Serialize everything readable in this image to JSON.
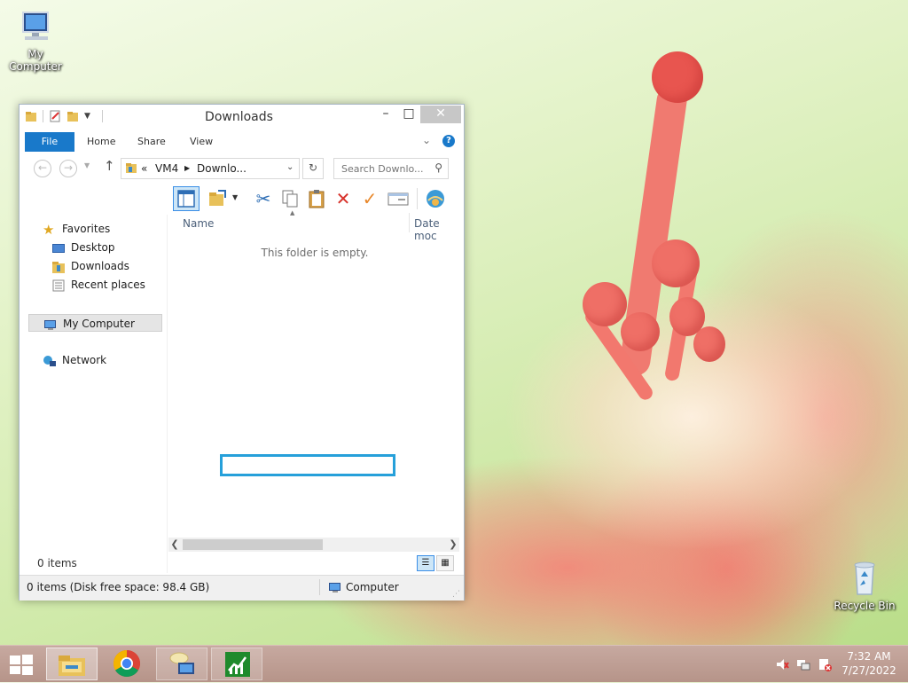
{
  "desktop": {
    "icons": [
      {
        "label": "My Computer"
      },
      {
        "label": "Recycle Bin"
      }
    ]
  },
  "window": {
    "title": "Downloads",
    "controls": {
      "minimize": "–",
      "maximize": "□",
      "close": "✕"
    },
    "ribbon_tabs": [
      "File",
      "Home",
      "Share",
      "View"
    ],
    "address": {
      "prefix": "«",
      "segments": [
        "VM4",
        "Downlo..."
      ]
    },
    "search": {
      "placeholder": "Search Downlo..."
    },
    "nav_pane": {
      "favorites": "Favorites",
      "favorite_items": [
        "Desktop",
        "Downloads",
        "Recent places"
      ],
      "computer": "My Computer",
      "network": "Network"
    },
    "columns": {
      "name": "Name",
      "date": "Date moc"
    },
    "empty_message": "This folder is empty.",
    "item_count": "0 items",
    "status": {
      "left": "0 items (Disk free space: 98.4 GB)",
      "right": "Computer"
    }
  },
  "taskbar": {
    "time": "7:32 AM",
    "date": "7/27/2022"
  },
  "colors": {
    "accent": "#1979ca",
    "rename_border": "#26a0da",
    "taskbar": "#c7a9a0"
  }
}
